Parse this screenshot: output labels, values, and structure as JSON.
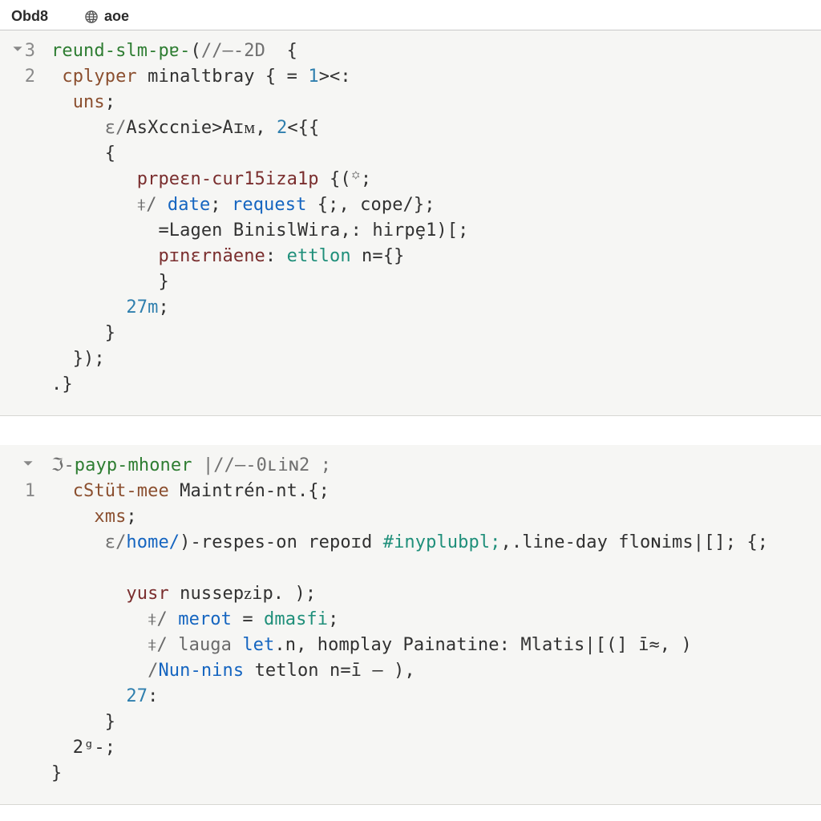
{
  "tabs": [
    {
      "label": "Obd8",
      "icon": null
    },
    {
      "label": "aoe",
      "icon": "globe-icon"
    }
  ],
  "panels": [
    {
      "id": "panel-1",
      "gutter": [
        "▾3",
        "2",
        "",
        "",
        "",
        "",
        "",
        "",
        "",
        "",
        "",
        "",
        "",
        ""
      ],
      "lines": [
        [
          {
            "t": "reund-slm-pɐ-",
            "c": "c-tag"
          },
          {
            "t": "(",
            "c": "c-punc"
          },
          {
            "t": "//—-2D",
            "c": "c-gray"
          },
          {
            "t": "  {",
            "c": "c-punc"
          }
        ],
        [
          {
            "t": " ",
            "c": "c-punc"
          },
          {
            "t": "cplyper",
            "c": "c-brown"
          },
          {
            "t": " minaltbray { ",
            "c": "c-text"
          },
          {
            "t": "=",
            "c": "c-punc"
          },
          {
            "t": " 1",
            "c": "c-num"
          },
          {
            "t": "><:",
            "c": "c-punc"
          }
        ],
        [
          {
            "t": "  uns",
            "c": "c-brown"
          },
          {
            "t": ";",
            "c": "c-punc"
          }
        ],
        [
          {
            "t": "     ε/",
            "c": "c-gray"
          },
          {
            "t": "AsXccnie>Aɪᴍ",
            "c": "c-text"
          },
          {
            "t": ", ",
            "c": "c-punc"
          },
          {
            "t": "2",
            "c": "c-num"
          },
          {
            "t": "<{{",
            "c": "c-punc"
          }
        ],
        [
          {
            "t": "     {",
            "c": "c-punc"
          }
        ],
        [
          {
            "t": "        ",
            "c": "c-punc"
          },
          {
            "t": "prpeɛn-cur15iza1p",
            "c": "c-fn"
          },
          {
            "t": " {(",
            "c": "c-punc"
          },
          {
            "t": "꙳",
            "c": "c-gray"
          },
          {
            "t": ";",
            "c": "c-punc"
          }
        ],
        [
          {
            "t": "        ⧧/ ",
            "c": "c-com"
          },
          {
            "t": "date",
            "c": "c-kw"
          },
          {
            "t": "; ",
            "c": "c-punc"
          },
          {
            "t": "request",
            "c": "c-kw"
          },
          {
            "t": " {;, ",
            "c": "c-punc"
          },
          {
            "t": "cope/",
            "c": "c-text"
          },
          {
            "t": "};",
            "c": "c-punc"
          }
        ],
        [
          {
            "t": "          =Lagen BinislWira,: hirpȩ1)[;",
            "c": "c-text"
          }
        ],
        [
          {
            "t": "          ",
            "c": "c-punc"
          },
          {
            "t": "pɪnɛrnäene",
            "c": "c-fn"
          },
          {
            "t": ": ",
            "c": "c-punc"
          },
          {
            "t": "ettlon",
            "c": "c-teal"
          },
          {
            "t": " n",
            "c": "c-text"
          },
          {
            "t": "={}",
            "c": "c-punc"
          }
        ],
        [
          {
            "t": "          }",
            "c": "c-punc"
          }
        ],
        [
          {
            "t": "       ",
            "c": "c-punc"
          },
          {
            "t": "27m",
            "c": "c-num"
          },
          {
            "t": ";",
            "c": "c-punc"
          }
        ],
        [
          {
            "t": "     }",
            "c": "c-punc"
          }
        ],
        [
          {
            "t": "  });",
            "c": "c-punc"
          }
        ],
        [
          {
            "t": ".}",
            "c": "c-punc"
          }
        ]
      ]
    },
    {
      "id": "panel-2",
      "gutter": [
        "▾  ",
        "1",
        "",
        "",
        "",
        "",
        "",
        "",
        "",
        "",
        "",
        "",
        ""
      ],
      "lines": [
        [
          {
            "t": "ℑ-",
            "c": "c-gray"
          },
          {
            "t": "payp-mhoner",
            "c": "c-tag"
          },
          {
            "t": " |//—-0ʟiɴ2 ;",
            "c": "c-gray"
          }
        ],
        [
          {
            "t": "  ",
            "c": "c-punc"
          },
          {
            "t": "cStüt-mee",
            "c": "c-brown"
          },
          {
            "t": " Maintrén-nt.{;",
            "c": "c-text"
          }
        ],
        [
          {
            "t": "    xms",
            "c": "c-brown"
          },
          {
            "t": ";",
            "c": "c-punc"
          }
        ],
        [
          {
            "t": "     ε/",
            "c": "c-gray"
          },
          {
            "t": "home/",
            "c": "c-kw"
          },
          {
            "t": ")-respes-on repoɪd ",
            "c": "c-text"
          },
          {
            "t": "#inyplubpl;",
            "c": "c-teal"
          },
          {
            "t": ",.line-day floɴims|[]; {;",
            "c": "c-text"
          }
        ],
        [
          {
            "t": "",
            "c": "c-punc"
          }
        ],
        [
          {
            "t": "       ",
            "c": "c-punc"
          },
          {
            "t": "yusr",
            "c": "c-fn"
          },
          {
            "t": " nussepᴢip. );",
            "c": "c-text"
          }
        ],
        [
          {
            "t": "         ⧧/ ",
            "c": "c-com"
          },
          {
            "t": "merot",
            "c": "c-kw"
          },
          {
            "t": " = ",
            "c": "c-punc"
          },
          {
            "t": "dmasfi",
            "c": "c-lit"
          },
          {
            "t": ";",
            "c": "c-punc"
          }
        ],
        [
          {
            "t": "         ⧧/ lauga ",
            "c": "c-com"
          },
          {
            "t": "let",
            "c": "c-kw"
          },
          {
            "t": ".n, homplay Painatine: Mlatis|[(] ī≈, )",
            "c": "c-text"
          }
        ],
        [
          {
            "t": "         /",
            "c": "c-com"
          },
          {
            "t": "Nun-nins",
            "c": "c-kw"
          },
          {
            "t": " tetlon n=ī — ),",
            "c": "c-text"
          }
        ],
        [
          {
            "t": "       ",
            "c": "c-punc"
          },
          {
            "t": "27",
            "c": "c-num"
          },
          {
            "t": ":",
            "c": "c-punc"
          }
        ],
        [
          {
            "t": "     }",
            "c": "c-punc"
          }
        ],
        [
          {
            "t": "  2ᵍ-;",
            "c": "c-text"
          }
        ],
        [
          {
            "t": "}",
            "c": "c-punc"
          }
        ]
      ]
    }
  ]
}
